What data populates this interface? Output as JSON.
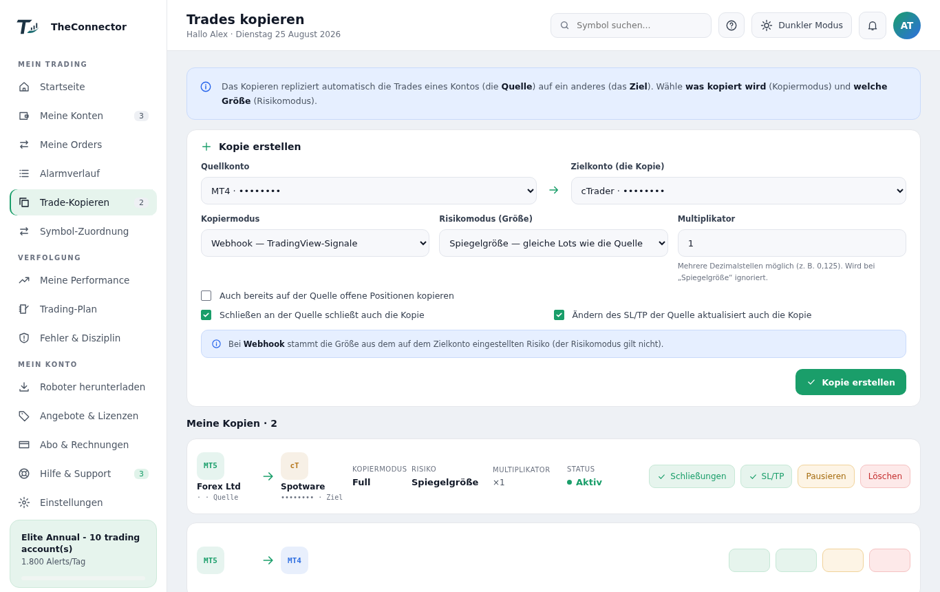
{
  "brand": {
    "name": "TheConnector"
  },
  "sidebar": {
    "sections": [
      {
        "title": "MEIN TRADING",
        "items": [
          {
            "label": "Startseite",
            "selected": false
          },
          {
            "label": "Meine Konten",
            "selected": false,
            "badge": "3"
          },
          {
            "label": "Meine Orders",
            "selected": false
          },
          {
            "label": "Alarmverlauf",
            "selected": false
          },
          {
            "label": "Trade-Kopieren",
            "selected": true,
            "badge": "2"
          },
          {
            "label": "Symbol-Zuordnung",
            "selected": false
          }
        ]
      },
      {
        "title": "VERFOLGUNG",
        "items": [
          {
            "label": "Meine Performance",
            "selected": false
          },
          {
            "label": "Trading-Plan",
            "selected": false
          },
          {
            "label": "Fehler & Disziplin",
            "selected": false
          }
        ]
      },
      {
        "title": "MEIN KONTO",
        "items": [
          {
            "label": "Roboter herunterladen",
            "selected": false
          },
          {
            "label": "Angebote & Lizenzen",
            "selected": false
          },
          {
            "label": "Abo & Rechnungen",
            "selected": false
          },
          {
            "label": "Hilfe & Support",
            "selected": false,
            "badge": "3",
            "color": "#1a9e6a"
          },
          {
            "label": "Einstellungen",
            "selected": false
          }
        ]
      }
    ],
    "plan": {
      "title": "Elite Annual - 10 trading account(s)",
      "subtitle": "1.800 Alerts/Tag"
    }
  },
  "header": {
    "title": "Trades kopieren",
    "subtitle": "Hallo Alex · Dienstag 25 August 2026",
    "search": {
      "placeholder": "Symbol suchen..."
    },
    "theme_button": "Dunkler Modus",
    "avatar": "AT"
  },
  "info": "Das Kopieren repliziert automatisch die Trades eines Kontos (die **Quelle**) auf ein anderes (das **Ziel**). Wähle **was kopiert wird** (Kopiermodus) und **welche Größe** (Risikomodus).",
  "form": {
    "title": "Kopie erstellen",
    "source": {
      "label": "Quellkonto",
      "value": "MT4 · ••••••••"
    },
    "target": {
      "label": "Zielkonto (die Kopie)",
      "value": "cTrader · ••••••••"
    },
    "copy_mode": {
      "label": "Kopiermodus",
      "value": "Webhook — TradingView-Signale"
    },
    "risk_mode": {
      "label": "Risikomodus (Größe)",
      "value": "Spiegelgröße — gleiche Lots wie die Quelle"
    },
    "multiplier": {
      "label": "Multiplikator",
      "value": "1",
      "hint": "Mehrere Dezimalstellen möglich (z. B. 0,125). Wird bei „Spiegelgröße“ ignoriert."
    },
    "options": [
      {
        "label": "Auch bereits auf der Quelle offene Positionen kopieren",
        "checked": false
      },
      {
        "label": "Schließen an der Quelle schließt auch die Kopie",
        "checked": true
      },
      {
        "label": "Ändern des SL/TP der Quelle aktualisiert auch die Kopie",
        "checked": true
      }
    ],
    "note": "Bei **Webhook** stammt die Größe aus dem auf dem Zielkonto eingestellten Risiko (der Risikomodus gilt nicht).",
    "submit": "Kopie erstellen"
  },
  "copies": {
    "title": "Meine Kopien · 2",
    "rows": [
      {
        "source": {
          "badge": "MT5",
          "color": "#1a9e6a",
          "name": "Forex Ltd",
          "sub": "· · Quelle"
        },
        "target": {
          "badge": "cT",
          "color": "#b7791f",
          "name": "Spotware",
          "sub": "•••••••• · Ziel"
        },
        "mode_label": "KOPIERMODUS",
        "mode": "Full",
        "risk_label": "RISIKO",
        "risk": "Spiegelgröße",
        "mult_label": "MULTIPLIKATOR",
        "mult": "×1",
        "status_label": "STATUS",
        "status": "Aktiv",
        "actions": [
          {
            "kind": "toggle",
            "label": "Schließungen",
            "checked": true
          },
          {
            "kind": "toggle",
            "label": "SL/TP",
            "checked": true
          },
          {
            "kind": "pause",
            "label": "Pausieren"
          },
          {
            "kind": "delete",
            "label": "Löschen"
          }
        ]
      },
      {
        "source": {
          "badge": "MT5",
          "color": "#1a9e6a"
        },
        "target": {
          "badge": "MT4",
          "color": "#2f6fe0"
        },
        "actions": [
          {
            "kind": "toggle"
          },
          {
            "kind": "toggle"
          },
          {
            "kind": "pause"
          },
          {
            "kind": "delete"
          }
        ]
      }
    ]
  }
}
